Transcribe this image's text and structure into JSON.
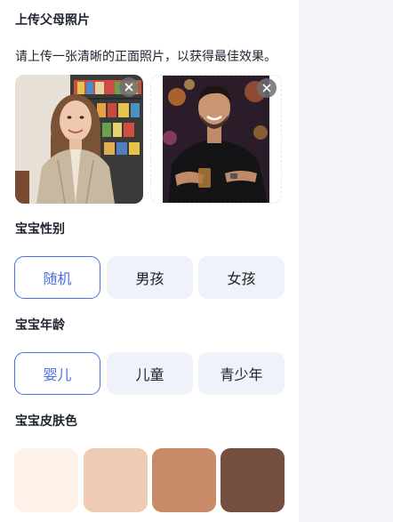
{
  "upload": {
    "title": "上传父母照片",
    "hint": "请上传一张清晰的正面照片，以获得最佳效果。"
  },
  "gender": {
    "title": "宝宝性别",
    "options": [
      "随机",
      "男孩",
      "女孩"
    ],
    "selected": "随机"
  },
  "age": {
    "title": "宝宝年龄",
    "options": [
      "婴儿",
      "儿童",
      "青少年"
    ],
    "selected": "婴儿"
  },
  "skin": {
    "title": "宝宝皮肤色",
    "colors": [
      "#fff2ea",
      "#edcbb4",
      "#c98b67",
      "#744f3f"
    ]
  },
  "colors": {
    "accent": "#4a6ee0",
    "option_bg": "#eff2f8",
    "page_bg": "#f3f4f8"
  }
}
